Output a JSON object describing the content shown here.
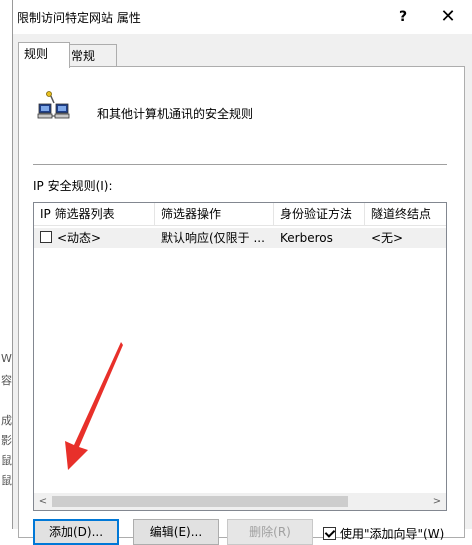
{
  "window": {
    "title": "限制访问特定网站 属性",
    "help_glyph": "?",
    "close_glyph": "✕"
  },
  "background_fragments": [
    "W",
    "容",
    "成",
    "影",
    "鼠",
    "鼠"
  ],
  "tabs": [
    {
      "label": "规则",
      "active": true
    },
    {
      "label": "常规",
      "active": false
    }
  ],
  "description": "和其他计算机通讯的安全规则",
  "rules_label": "IP 安全规则(I):",
  "table": {
    "columns": [
      "IP 筛选器列表",
      "筛选器操作",
      "身份验证方法",
      "隧道终结点"
    ],
    "rows": [
      {
        "checked": false,
        "cells": [
          "<动态>",
          "默认响应(仅限于 ...",
          "Kerberos",
          "<无>"
        ]
      }
    ]
  },
  "scroll": {
    "left_glyph": "<",
    "right_glyph": ">"
  },
  "buttons": {
    "add": "添加(D)...",
    "edit": "编辑(E)...",
    "remove": "删除(R)"
  },
  "wizard": {
    "label": "使用\"添加向导\"(W)",
    "checked": true
  },
  "colors": {
    "annotation_arrow": "#e8302a",
    "focus_border": "#0078d7"
  }
}
